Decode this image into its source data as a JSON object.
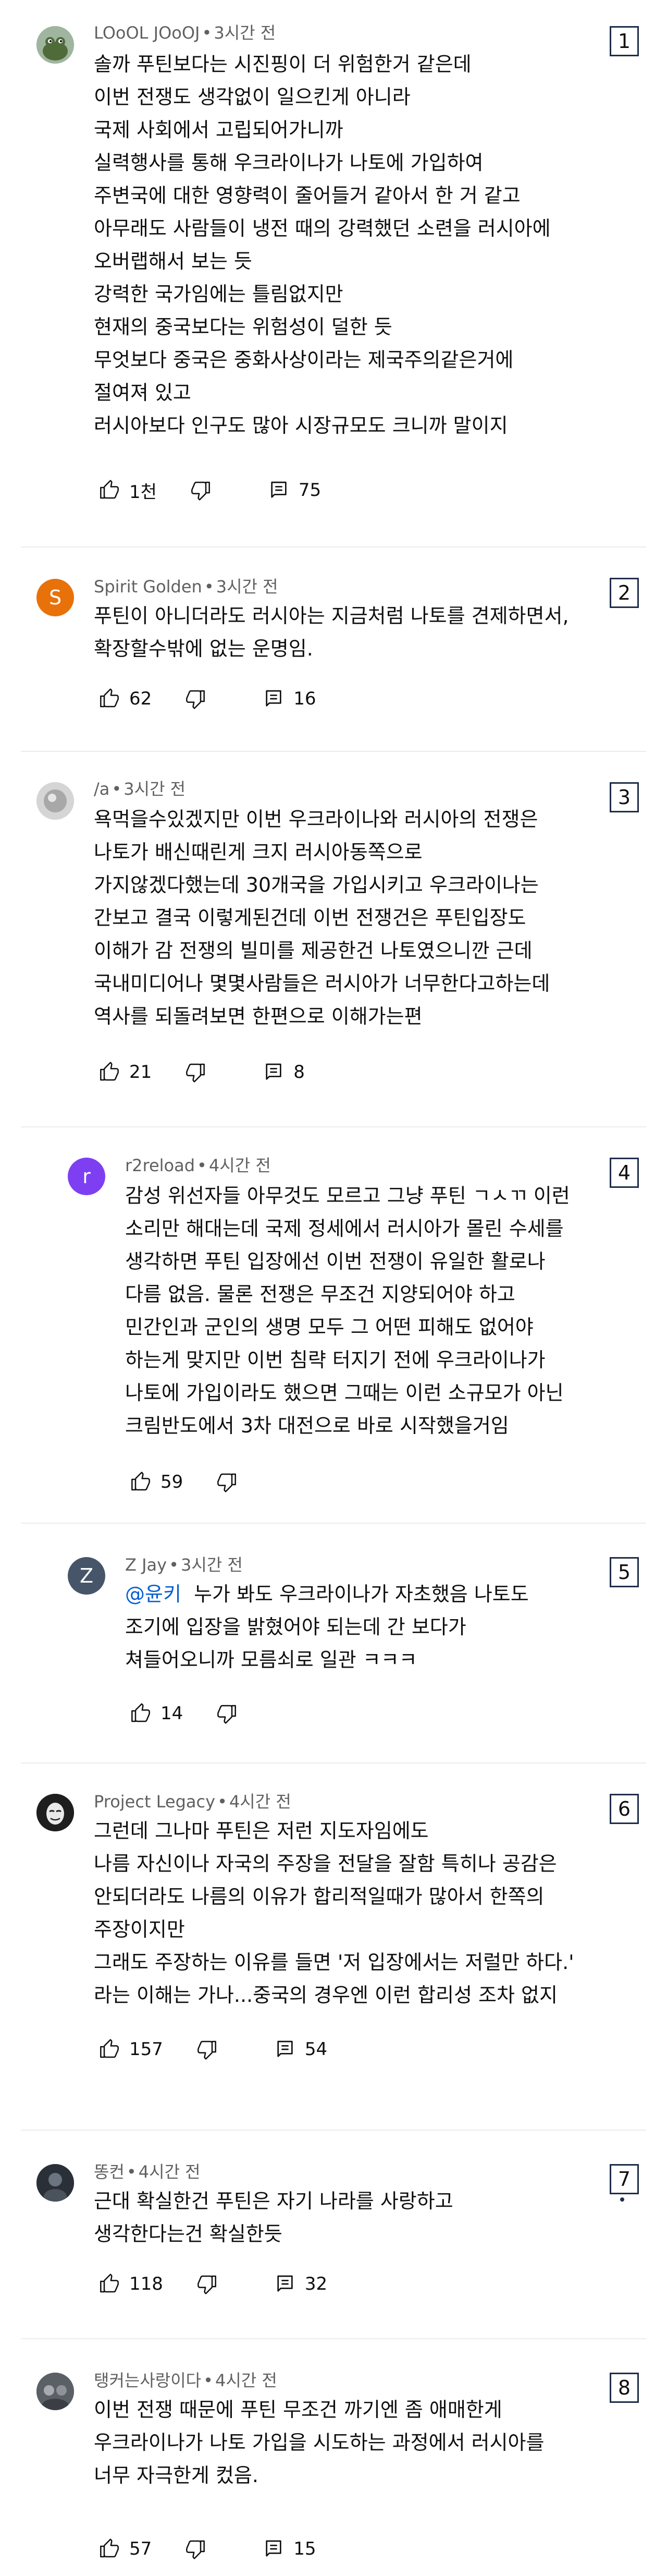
{
  "comments": [
    {
      "author": "LOoOL JOoOJ",
      "time": "3시간 전",
      "number": "1",
      "lines": [
        "솔까 푸틴보다는 시진핑이 더 위험한거 같은데",
        "이번 전쟁도 생각없이 일으킨게 아니라",
        "국제 사회에서 고립되어가니까",
        "실력행사를 통해 우크라이나가 나토에 가입하여",
        "주변국에 대한 영향력이 줄어들거 같아서 한 거 같고",
        "아무래도 사람들이 냉전 때의 강력했던 소련을 러시아에",
        "오버랩해서 보는 듯",
        "강력한 국가임에는 틀림없지만",
        "현재의 중국보다는 위험성이 덜한 듯",
        "무엇보다 중국은 중화사상이라는 제국주의같은거에",
        "절여져 있고",
        "러시아보다 인구도 많아 시장규모도 크니까 말이지"
      ],
      "likes": "1천",
      "replies": "75"
    },
    {
      "author": "Spirit Golden",
      "time": "3시간 전",
      "number": "2",
      "avatar_letter": "S",
      "lines": [
        "푸틴이 아니더라도 러시아는 지금처럼 나토를 견제하면서,",
        "확장할수밖에 없는 운명임."
      ],
      "likes": "62",
      "replies": "16"
    },
    {
      "author": "/a",
      "time": "3시간 전",
      "number": "3",
      "lines": [
        "욕먹을수있겠지만 이번 우크라이나와 러시아의 전쟁은",
        "나토가 배신때린게 크지 러시아동쪽으로",
        "가지않겠다했는데 30개국을 가입시키고 우크라이나는",
        "간보고 결국 이렇게된건데 이번 전쟁건은 푸틴입장도",
        "이해가 감 전쟁의 빌미를 제공한건 나토였으니깐 근데",
        "국내미디어나 몇몇사람들은 러시아가 너무한다고하는데",
        "역사를 되돌려보면 한편으로 이해가는편"
      ],
      "likes": "21",
      "replies": "8"
    },
    {
      "author": "r2reload",
      "time": "4시간 전",
      "number": "4",
      "avatar_letter": "r",
      "lines": [
        "감성 위선자들 아무것도 모르고 그냥 푸틴 ㄱㅅㄲ 이런",
        "소리만 해대는데 국제 정세에서 러시아가 몰린 수세를",
        "생각하면 푸틴 입장에선 이번 전쟁이 유일한 활로나",
        "다름 없음. 물론 전쟁은 무조건 지양되어야 하고",
        "민간인과 군인의 생명 모두 그 어떤 피해도 없어야",
        "하는게 맞지만 이번 침략 터지기 전에 우크라이나가",
        "나토에 가입이라도 했으면 그때는 이런 소규모가 아닌",
        "크림반도에서 3차 대전으로 바로 시작했을거임"
      ],
      "likes": "59"
    },
    {
      "author": "Z Jay",
      "time": "3시간 전",
      "number": "5",
      "avatar_letter": "Z",
      "mention": "@윤키",
      "lines": [
        "누가 봐도 우크라이나가 자초했음 나토도",
        "조기에 입장을 밝혔어야 되는데 간 보다가",
        "쳐들어오니까 모름쇠로 일관 ㅋㅋㅋ"
      ],
      "likes": "14"
    },
    {
      "author": "Project Legacy",
      "time": "4시간 전",
      "number": "6",
      "lines": [
        "그런데 그나마 푸틴은 저런 지도자임에도",
        "나름 자신이나 자국의 주장을 전달을 잘함 특히나 공감은",
        "안되더라도 나름의 이유가 합리적일때가 많아서 한쪽의",
        "주장이지만",
        "그래도 주장하는 이유를 들면 '저 입장에서는 저럴만 하다.'",
        "라는 이해는 가나...중국의 경우엔 이런 합리성 조차 없지"
      ],
      "likes": "157",
      "replies": "54"
    },
    {
      "author": "똥컨",
      "time": "4시간 전",
      "number": "7",
      "lines": [
        "근대 확실한건 푸틴은 자기 나라를 사랑하고",
        "생각한다는건 확실한듯"
      ],
      "likes": "118",
      "replies": "32"
    },
    {
      "author": "탱커는사랑이다",
      "time": "4시간 전",
      "number": "8",
      "lines": [
        "이번 전쟁 때문에 푸틴 무조건 까기엔 좀 애매한게",
        "우크라이나가 나토 가입을 시도하는 과정에서 러시아를",
        "너무 자극한게 컸음."
      ],
      "likes": "57",
      "replies": "15"
    }
  ],
  "colors": {
    "text": "#0f0f0f",
    "meta": "#606060",
    "mention": "#065fd4",
    "badge_border": "#1f2d4a",
    "avatar_orange": "#e8710a",
    "avatar_purple": "#7e3ff2",
    "avatar_slate": "#475569"
  },
  "icons": [
    "thumb-up-icon",
    "thumb-down-icon",
    "reply-comment-icon"
  ]
}
